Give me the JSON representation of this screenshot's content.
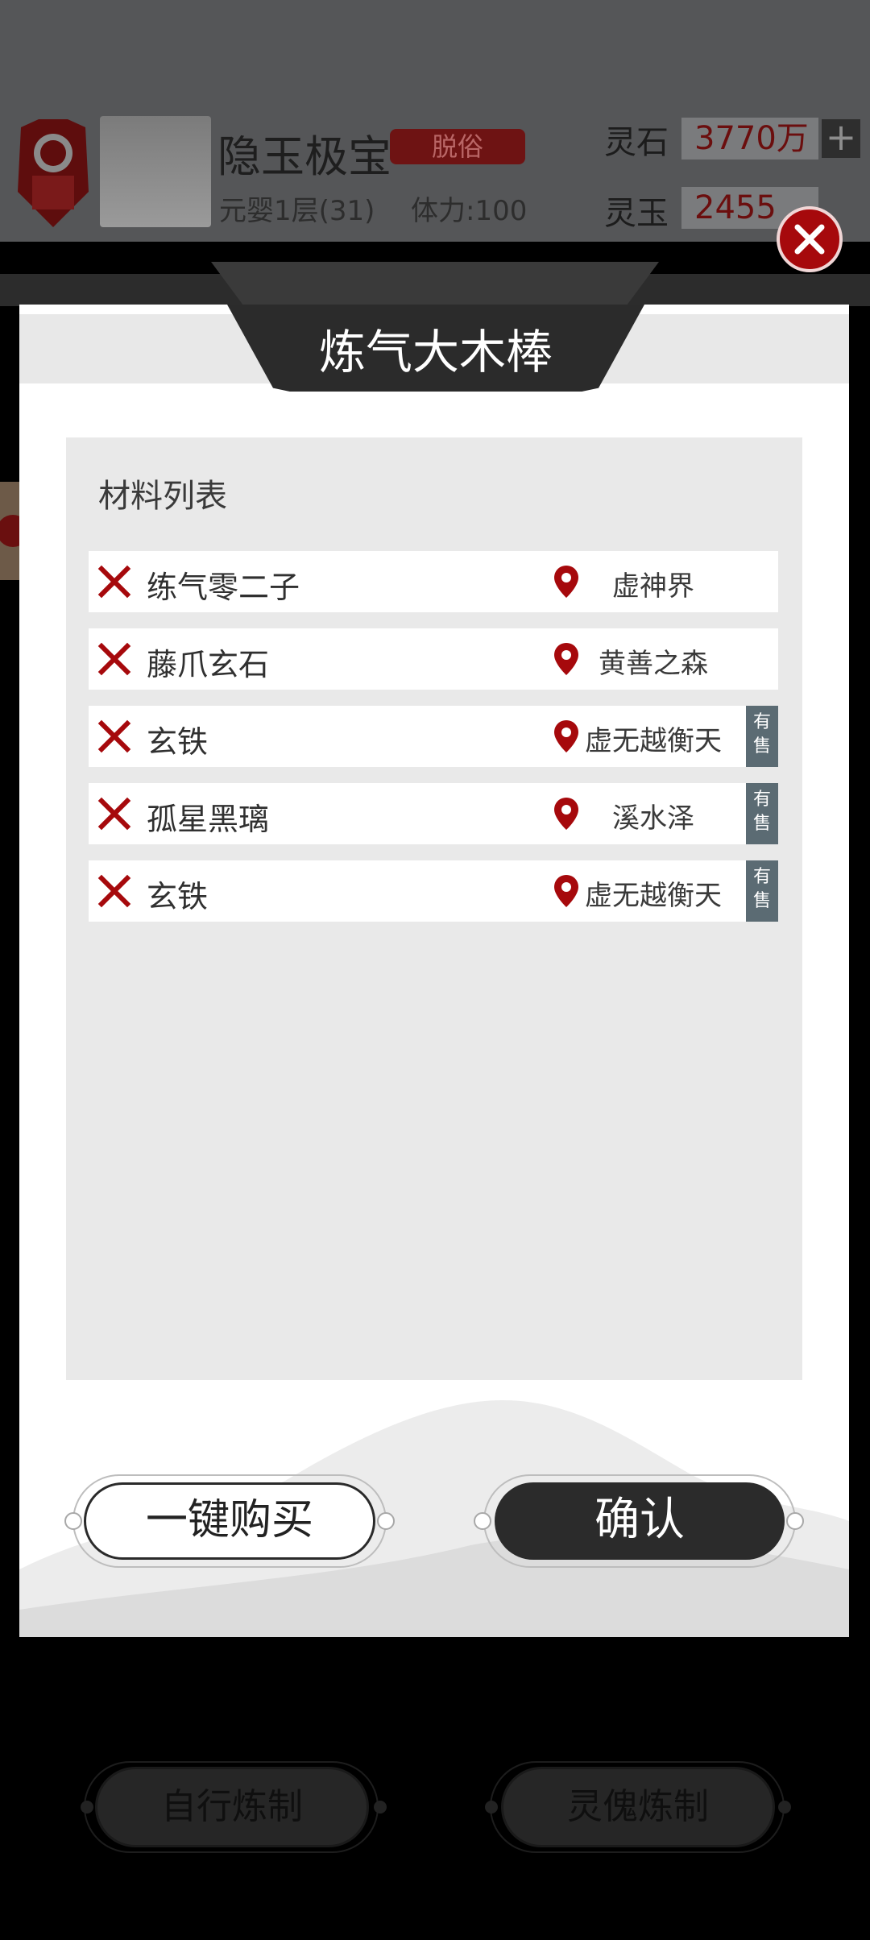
{
  "header": {
    "player_name": "隐玉极宝",
    "rank": "脱俗",
    "level": "元婴1层(31)",
    "stamina": "体力:100",
    "currencies": [
      {
        "label": "灵石",
        "value": "3770万"
      },
      {
        "label": "灵玉",
        "value": "2455"
      }
    ],
    "plus": "+"
  },
  "bottom_buttons": [
    "自行炼制",
    "灵傀炼制"
  ],
  "modal": {
    "title": "炼气大木棒",
    "panel_title": "材料列表",
    "materials": [
      {
        "name": "练气零二子",
        "location": "虚神界",
        "for_sale": false
      },
      {
        "name": "藤爪玄石",
        "location": "黄善之森",
        "for_sale": false
      },
      {
        "name": "玄铁",
        "location": "虚无越衡天",
        "for_sale": true
      },
      {
        "name": "孤星黑璃",
        "location": "溪水泽",
        "for_sale": true
      },
      {
        "name": "玄铁",
        "location": "虚无越衡天",
        "for_sale": true
      }
    ],
    "sale_tag": {
      "line1": "有",
      "line2": "售"
    },
    "buy_all_label": "一键购买",
    "confirm_label": "确认"
  },
  "colors": {
    "accent_red": "#a6090c",
    "dark": "#2b2b2b",
    "tag_slate": "#5b6b73"
  },
  "icons": {
    "close": "close-icon",
    "remove": "x-icon",
    "location": "map-pin-icon"
  }
}
